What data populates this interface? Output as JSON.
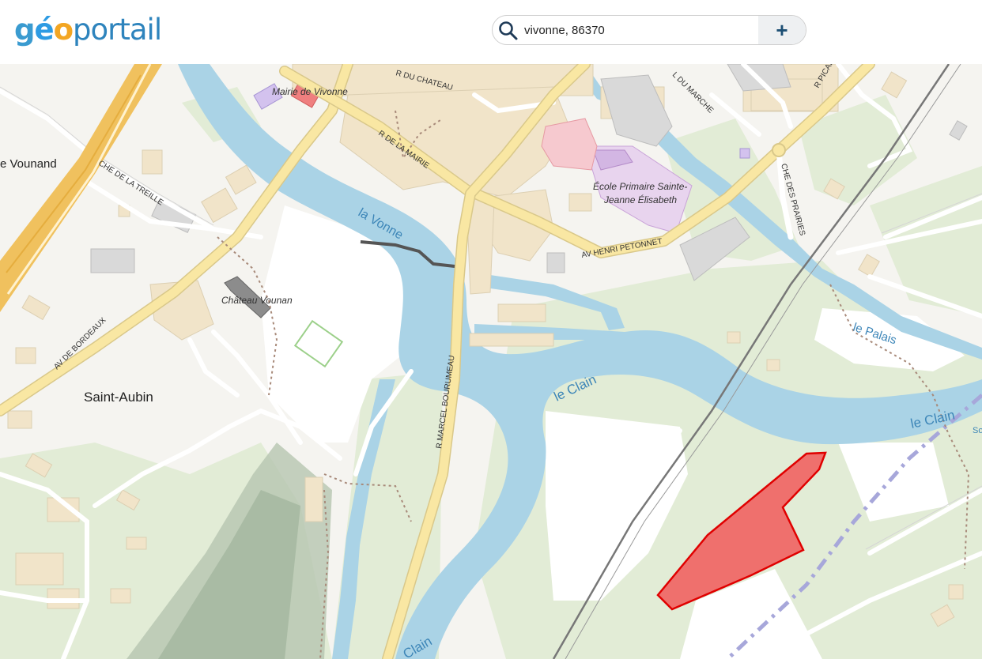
{
  "header": {
    "logo": {
      "g": "g",
      "e": "é",
      "o": "o",
      "rest": "portail"
    },
    "search": {
      "value": "vivonne, 86370",
      "add_label": "+"
    }
  },
  "map": {
    "labels": {
      "mairie": "Mairie de Vivonne",
      "r_du_chateau": "R DU CHATEAU",
      "l_du_marche": "L DU MARCHE",
      "r_picard": "R PICAR",
      "vounand": "e Vounand",
      "che_treille": "CHE DE LA TREILLE",
      "r_mairie": "R DE LA MAIRIE",
      "la_vonne": "la Vonne",
      "ecole_1": "École Primaire Sainte-",
      "ecole_2": "Jeanne Élisabeth",
      "che_prairies": "CHE DES PRAIRIES",
      "av_henri": "AV HENRI PETONNET",
      "chateau_vounan": "Château Vounan",
      "le_palais": "le Palais",
      "av_bordeaux": "AV DE BORDEAUX",
      "saint_aubin": "Saint-Aubin",
      "r_marcel": "R MARCEL BOURUMEAU",
      "le_clain_1": "le Clain",
      "le_clain_2": "le Clain",
      "clain_bottom": "Clain",
      "so": "So"
    },
    "colors": {
      "water": "#aad3e6",
      "road_main": "#f9e7a3",
      "highway": "#f0c15e",
      "building": "#f1e4c9",
      "green": "#e2ecd6",
      "parcel_fill": "#f15b5b",
      "parcel_stroke": "#e00000"
    }
  }
}
